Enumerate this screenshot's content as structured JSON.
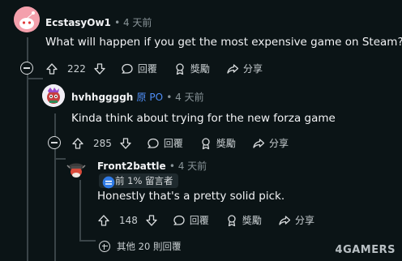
{
  "comments": [
    {
      "username": "EcstasyOw1",
      "time": "• 4 天前",
      "text": "What will happen if you get the most expensive game on Steam?",
      "votes": "222",
      "reply_label": "回覆",
      "award_label": "獎勵",
      "share_label": "分享"
    },
    {
      "username": "hvhhggggh",
      "op_tag": "原 PO",
      "time": "• 4 天前",
      "text": "Kinda think about trying for the new forza game",
      "votes": "285",
      "reply_label": "回覆",
      "award_label": "獎勵",
      "share_label": "分享"
    },
    {
      "username": "Front2battle",
      "time": "• 4 天前",
      "badge": "前 1% 留言者",
      "text": "Honestly that's a pretty solid pick.",
      "votes": "148",
      "reply_label": "回覆",
      "award_label": "獎勵",
      "share_label": "分享"
    }
  ],
  "more_replies": "其他 20 則回覆",
  "watermark": "4GAMERS",
  "colors": {
    "background": "#0b1416",
    "op_blue": "#4f8ef7",
    "thread_line": "#3a4448"
  }
}
